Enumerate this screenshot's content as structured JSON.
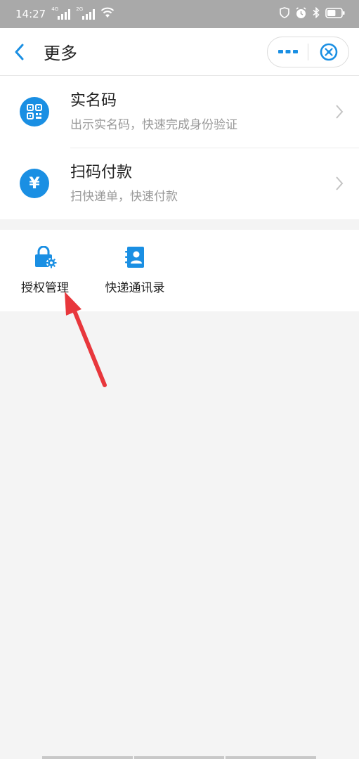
{
  "status_bar": {
    "time": "14:27",
    "signal1_tag": "4G",
    "signal2_tag": "2G",
    "battery_level": 0.6
  },
  "header": {
    "title": "更多"
  },
  "list": {
    "items": [
      {
        "title": "实名码",
        "subtitle": "出示实名码，快速完成身份验证",
        "icon": "qr-code-icon"
      },
      {
        "title": "扫码付款",
        "subtitle": "扫快递单，快速付款",
        "icon": "yuan-icon"
      }
    ]
  },
  "grid": {
    "items": [
      {
        "label": "授权管理",
        "icon": "lock-gear-icon"
      },
      {
        "label": "快递通讯录",
        "icon": "contacts-icon"
      }
    ]
  },
  "colors": {
    "accent": "#1a8fe3",
    "annotation_arrow": "#e8373c"
  }
}
